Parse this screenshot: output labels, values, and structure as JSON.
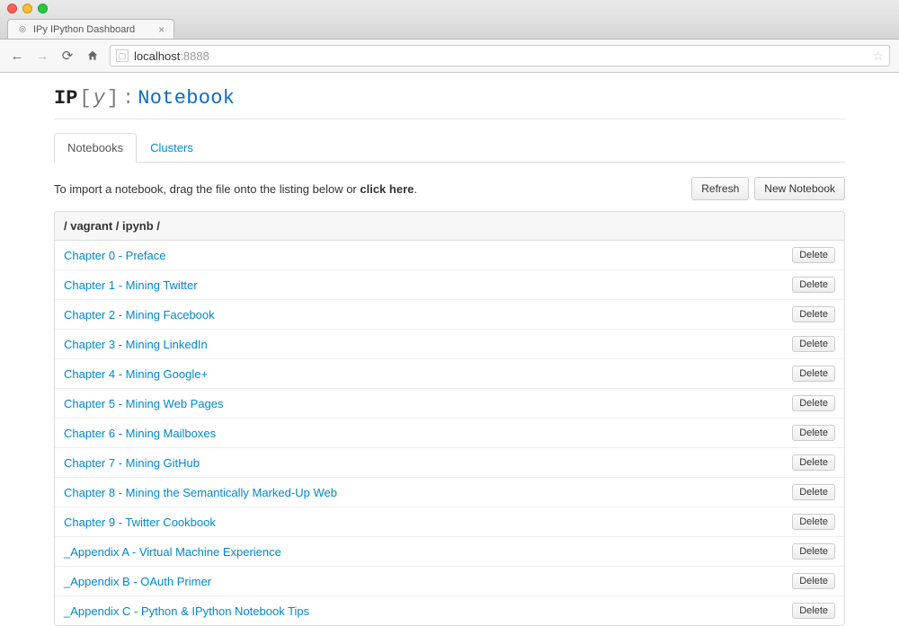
{
  "browser": {
    "tab_title": "IPy IPython Dashboard",
    "url_host": "localhost",
    "url_port": ":8888"
  },
  "logo": {
    "ip": "IP",
    "lbracket": "[",
    "y": "y",
    "rbracket": "]",
    "colon": ":",
    "notebook": "Notebook"
  },
  "tabs": [
    {
      "label": "Notebooks",
      "active": true
    },
    {
      "label": "Clusters",
      "active": false
    }
  ],
  "import_text_prefix": "To import a notebook, drag the file onto the listing below or ",
  "import_text_link": "click here",
  "import_text_suffix": ".",
  "buttons": {
    "refresh": "Refresh",
    "new_notebook": "New Notebook",
    "delete": "Delete"
  },
  "breadcrumb": "/ vagrant / ipynb /",
  "notebooks": [
    "Chapter 0 - Preface",
    "Chapter 1 - Mining Twitter",
    "Chapter 2 - Mining Facebook",
    "Chapter 3 - Mining LinkedIn",
    "Chapter 4 - Mining Google+",
    "Chapter 5 - Mining Web Pages",
    "Chapter 6 - Mining Mailboxes",
    "Chapter 7 - Mining GitHub",
    "Chapter 8 - Mining the Semantically Marked-Up Web",
    "Chapter 9 - Twitter Cookbook",
    "_Appendix A - Virtual Machine Experience",
    "_Appendix B - OAuth Primer",
    "_Appendix C - Python & IPython Notebook Tips"
  ]
}
